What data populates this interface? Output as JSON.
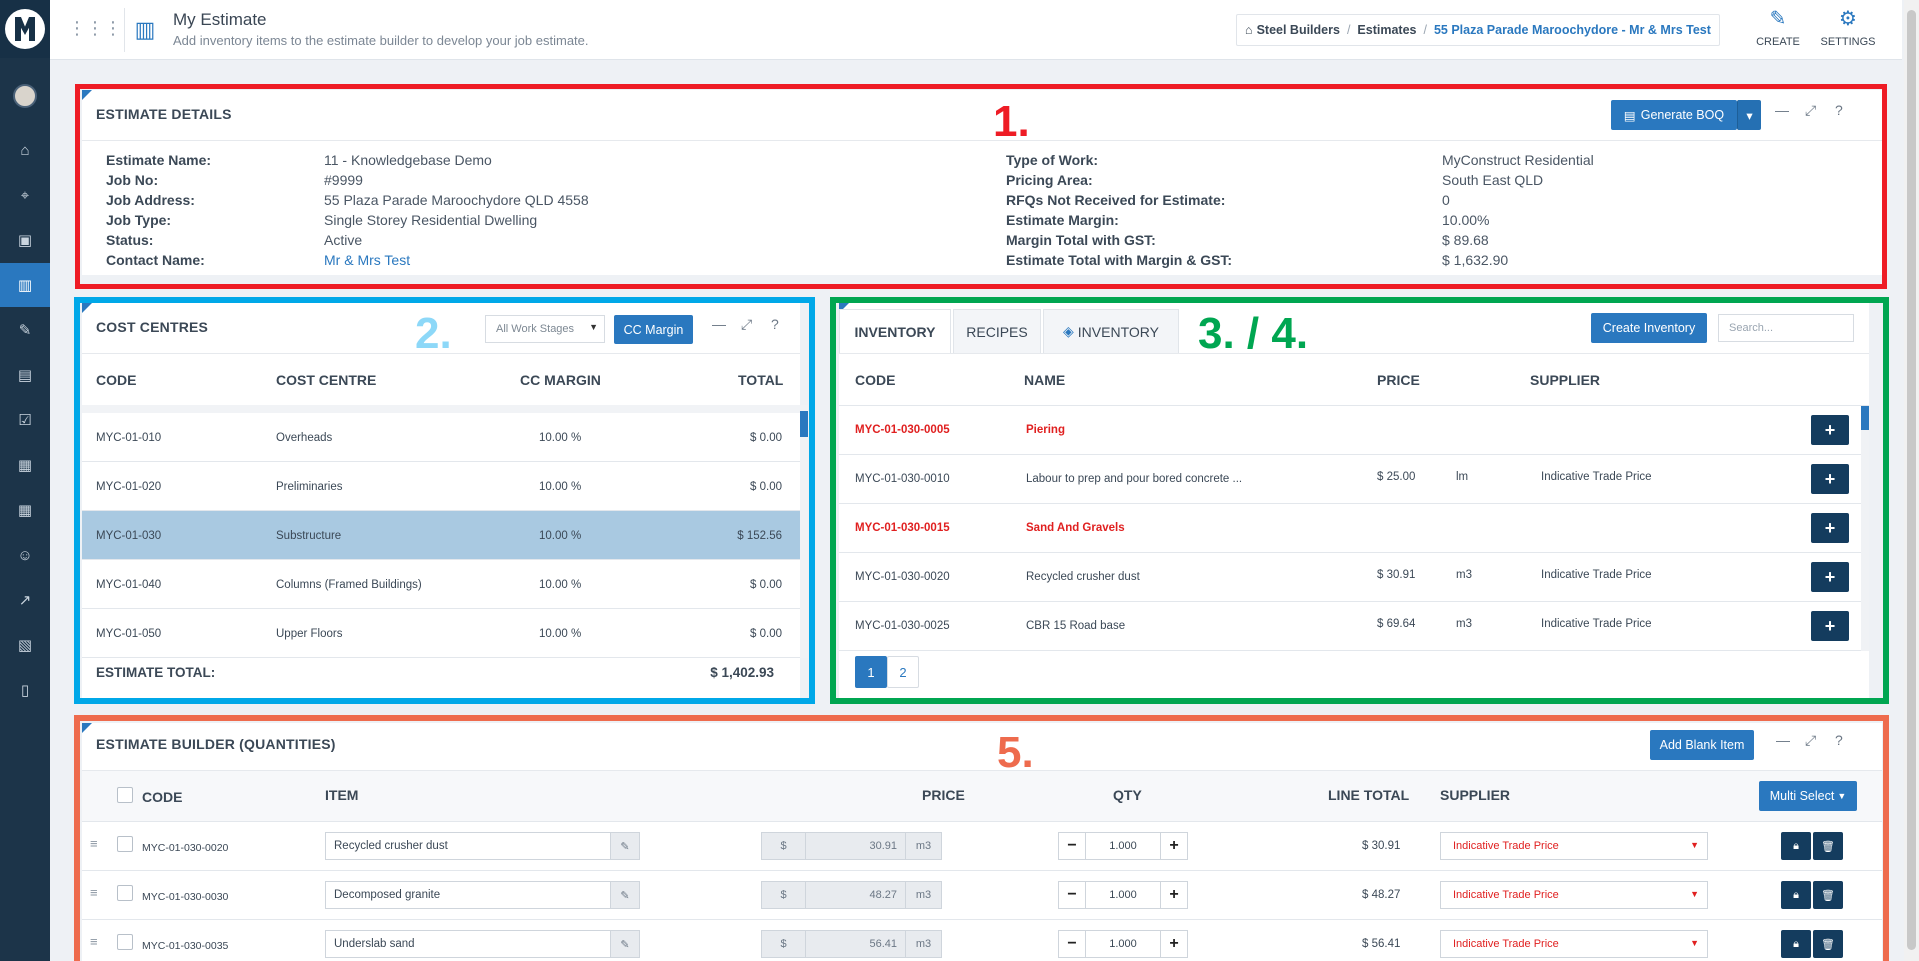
{
  "header": {
    "title": "My Estimate",
    "subtitle": "Add inventory items to the estimate builder to develop your job estimate.",
    "breadcrumb": [
      "Steel Builders",
      "Estimates",
      "55 Plaza Parade Maroochydore - Mr & Mrs Test"
    ],
    "create_label": "CREATE",
    "settings_label": "SETTINGS"
  },
  "markers": {
    "m1": "1.",
    "m2": "2.",
    "m34": "3.  /  4.",
    "m5": "5."
  },
  "colors": {
    "accent": "#2a78bf",
    "sidebar": "#1c3449",
    "red_outline": "#ee1c25",
    "blue_outline": "#00a8e8",
    "green_outline": "#00a651",
    "orange_outline": "#ee6b4d",
    "danger_text": "#e02020",
    "dark_button": "#143c5e"
  },
  "estimate_details": {
    "title": "ESTIMATE DETAILS",
    "generate_button": "Generate BOQ",
    "left": [
      {
        "label": "Estimate Name:",
        "value": "11 - Knowledgebase Demo"
      },
      {
        "label": "Job No:",
        "value": "#9999"
      },
      {
        "label": "Job Address:",
        "value": "55 Plaza Parade Maroochydore QLD 4558"
      },
      {
        "label": "Job Type:",
        "value": "Single Storey Residential Dwelling"
      },
      {
        "label": "Status:",
        "value": "Active"
      },
      {
        "label": "Contact Name:",
        "value": "Mr & Mrs Test"
      }
    ],
    "right": [
      {
        "label": "Type of Work:",
        "value": "MyConstruct Residential"
      },
      {
        "label": "Pricing Area:",
        "value": "South East QLD"
      },
      {
        "label": "RFQs Not Received for Estimate:",
        "value": "0"
      },
      {
        "label": "Estimate Margin:",
        "value": "10.00%"
      },
      {
        "label": "Margin Total with GST:",
        "value": "$ 89.68"
      },
      {
        "label": "Estimate Total with Margin & GST:",
        "value": "$ 1,632.90"
      }
    ]
  },
  "cost_centres": {
    "title": "COST CENTRES",
    "stage_select": "All Work Stages",
    "cc_margin_button": "CC Margin",
    "headers": [
      "CODE",
      "COST CENTRE",
      "CC MARGIN",
      "TOTAL"
    ],
    "rows": [
      {
        "code": "MYC-01-010",
        "name": "Overheads",
        "margin": "10.00 %",
        "total": "$ 0.00"
      },
      {
        "code": "MYC-01-020",
        "name": "Preliminaries",
        "margin": "10.00 %",
        "total": "$ 0.00"
      },
      {
        "code": "MYC-01-030",
        "name": "Substructure",
        "margin": "10.00 %",
        "total": "$ 152.56"
      },
      {
        "code": "MYC-01-040",
        "name": "Columns (Framed Buildings)",
        "margin": "10.00 %",
        "total": "$ 0.00"
      },
      {
        "code": "MYC-01-050",
        "name": "Upper Floors",
        "margin": "10.00 %",
        "total": "$ 0.00"
      }
    ],
    "total_label": "ESTIMATE TOTAL:",
    "total_value": "$ 1,402.93"
  },
  "inventory": {
    "tabs": [
      "INVENTORY",
      "RECIPES",
      "INVENTORY"
    ],
    "create_button": "Create Inventory",
    "search_placeholder": "Search...",
    "headers": [
      "CODE",
      "NAME",
      "PRICE",
      "SUPPLIER"
    ],
    "rows": [
      {
        "code": "MYC-01-030-0005",
        "name": "Piering",
        "price": "",
        "unit": "",
        "supplier": "",
        "heading": true
      },
      {
        "code": "MYC-01-030-0010",
        "name": "Labour to prep and pour bored concrete ...",
        "price": "$ 25.00",
        "unit": "lm",
        "supplier": "Indicative Trade Price",
        "heading": false
      },
      {
        "code": "MYC-01-030-0015",
        "name": "Sand And Gravels",
        "price": "",
        "unit": "",
        "supplier": "",
        "heading": true
      },
      {
        "code": "MYC-01-030-0020",
        "name": "Recycled crusher dust",
        "price": "$ 30.91",
        "unit": "m3",
        "supplier": "Indicative Trade Price",
        "heading": false
      },
      {
        "code": "MYC-01-030-0025",
        "name": "CBR 15 Road base",
        "price": "$ 69.64",
        "unit": "m3",
        "supplier": "Indicative Trade Price",
        "heading": false
      }
    ],
    "pages": [
      "1",
      "2"
    ],
    "plus": "+"
  },
  "builder": {
    "title": "ESTIMATE BUILDER (QUANTITIES)",
    "add_blank_button": "Add Blank Item",
    "multi_select_button": "Multi Select",
    "headers": [
      "CODE",
      "ITEM",
      "PRICE",
      "QTY",
      "LINE TOTAL",
      "SUPPLIER"
    ],
    "currency": "$",
    "rows": [
      {
        "code": "MYC-01-030-0020",
        "item": "Recycled crusher dust",
        "price": "30.91",
        "unit": "m3",
        "qty": "1.000",
        "line_total": "$ 30.91",
        "supplier": "Indicative Trade Price"
      },
      {
        "code": "MYC-01-030-0030",
        "item": "Decomposed granite",
        "price": "48.27",
        "unit": "m3",
        "qty": "1.000",
        "line_total": "$ 48.27",
        "supplier": "Indicative Trade Price"
      },
      {
        "code": "MYC-01-030-0035",
        "item": "Underslab sand",
        "price": "56.41",
        "unit": "m3",
        "qty": "1.000",
        "line_total": "$ 56.41",
        "supplier": "Indicative Trade Price"
      }
    ]
  }
}
